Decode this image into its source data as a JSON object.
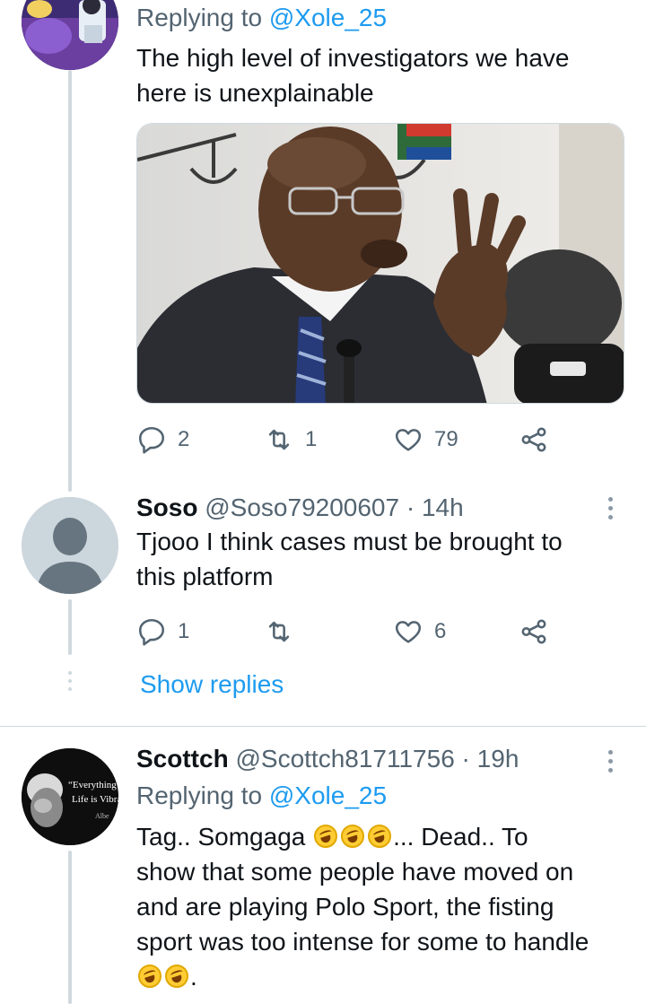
{
  "colors": {
    "accent": "#1d9bf0",
    "muted": "#536471",
    "border": "#cfd9de"
  },
  "tweet1": {
    "replying_prefix": "Replying to ",
    "replying_handle": "@Xole_25",
    "text_lines": [
      "The high level of investigators we have",
      "here is unexplainable"
    ],
    "media_description_icon": "photo",
    "actions": {
      "reply_count": "2",
      "retweet_count": "1",
      "like_count": "79"
    }
  },
  "tweet2": {
    "name": "Soso",
    "handle": "@Soso79200607",
    "separator": " · ",
    "time": "14h",
    "text_lines": [
      "Tjooo I think cases must be brought to",
      "this platform"
    ],
    "actions": {
      "reply_count": "1",
      "retweet_count": "",
      "like_count": "6"
    },
    "show_replies": "Show replies"
  },
  "tweet3": {
    "name": "Scottch",
    "handle": "@Scottch81711756",
    "separator": " · ",
    "time": "19h",
    "replying_prefix": "Replying to ",
    "replying_handle": "@Xole_25",
    "line1_start": "Tag.. Somgaga ",
    "line1_end": "... Dead.. To",
    "line2": "show that some people have moved on",
    "line3": "and are playing Polo Sport, the fisting",
    "line4": "sport was too intense for some to handle",
    "line5_end": ".",
    "avatar_quote": "“Everything i",
    "avatar_quote2": "Life is Vibra",
    "avatar_quote3": "Albe",
    "emoji_name": "rolling-on-the-floor-laughing"
  }
}
